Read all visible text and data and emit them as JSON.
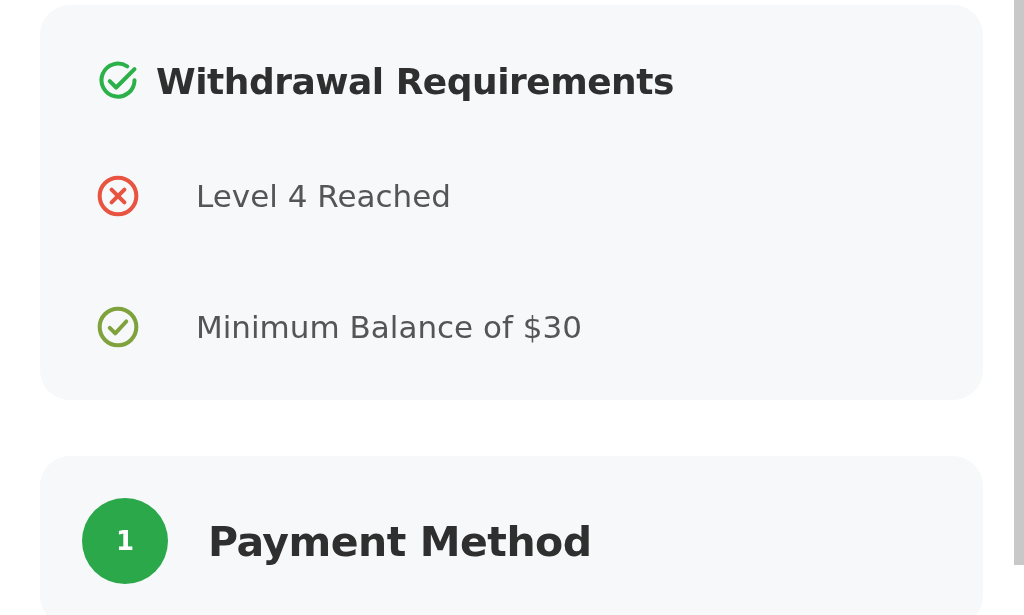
{
  "requirements": {
    "title": "Withdrawal Requirements",
    "items": [
      {
        "label": "Level 4 Reached",
        "met": false
      },
      {
        "label": "Minimum Balance of $30",
        "met": true
      }
    ]
  },
  "payment": {
    "step": "1",
    "title": "Payment Method"
  }
}
